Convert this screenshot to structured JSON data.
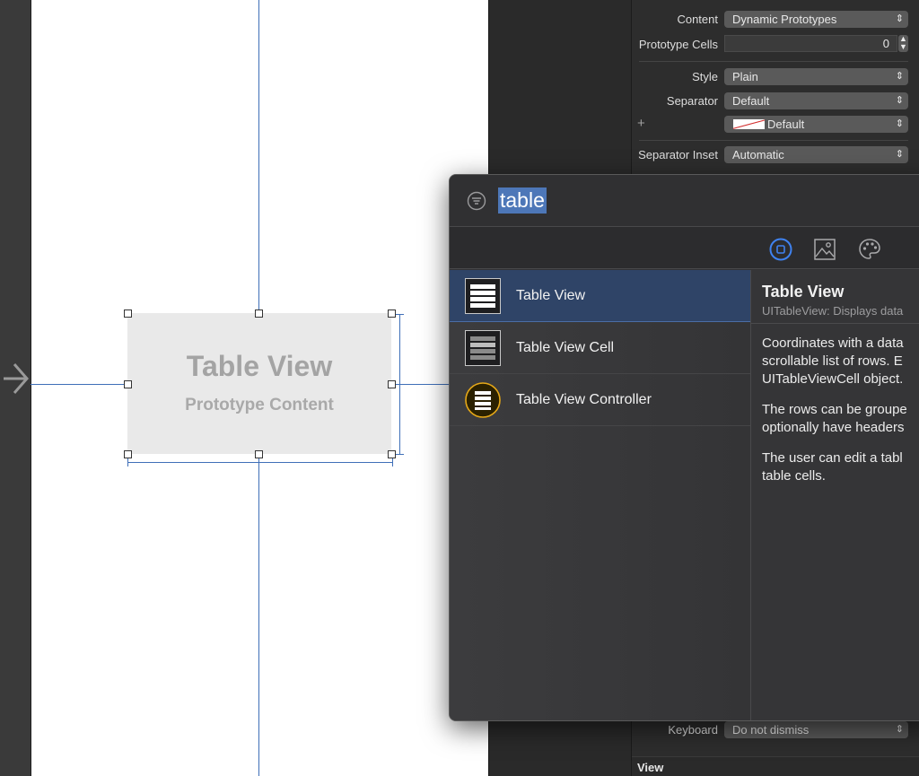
{
  "storyboard": {
    "placeholder_title": "Table View",
    "placeholder_subtitle": "Prototype Content"
  },
  "inspector": {
    "content": {
      "label": "Content",
      "value": "Dynamic Prototypes"
    },
    "prototype_cells": {
      "label": "Prototype Cells",
      "value": "0"
    },
    "style": {
      "label": "Style",
      "value": "Plain"
    },
    "separator": {
      "label": "Separator",
      "value": "Default"
    },
    "separator_color": {
      "plus": "+",
      "value": "Default"
    },
    "separator_inset": {
      "label": "Separator Inset",
      "value": "Automatic"
    },
    "keyboard": {
      "label": "Keyboard",
      "value": "Do not dismiss"
    },
    "section_view": "View"
  },
  "library": {
    "search_query": "table",
    "items": [
      {
        "label": "Table View",
        "icon": "table-view-icon",
        "selected": true
      },
      {
        "label": "Table View Cell",
        "icon": "table-view-cell-icon",
        "selected": false
      },
      {
        "label": "Table View Controller",
        "icon": "table-view-controller-icon",
        "selected": false
      }
    ],
    "detail": {
      "title": "Table View",
      "subtitle": "UITableView: Displays data",
      "p1": [
        "Coordinates with a data",
        "scrollable list of rows. E",
        "UITableViewCell object."
      ],
      "p2": [
        "The rows can be groupe",
        "optionally have headers"
      ],
      "p3": [
        "The user can edit a tabl",
        "table cells."
      ]
    }
  },
  "colors": {
    "selection_blue": "#4d77b8",
    "guide_blue": "#3f6fb8",
    "controller_yellow": "#e6a817"
  }
}
